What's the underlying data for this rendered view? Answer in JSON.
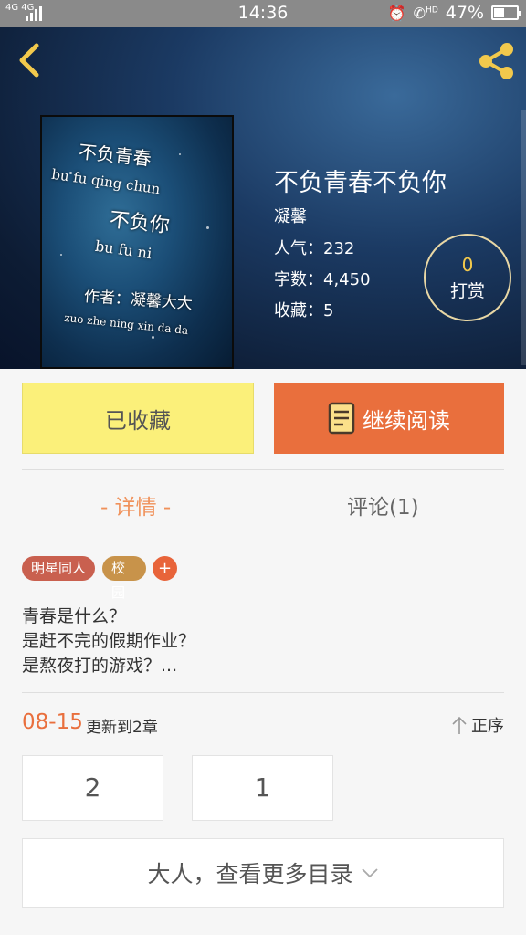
{
  "status_bar": {
    "network": "4G 4G",
    "time": "14:36",
    "hd_label": "HD",
    "battery": "47%",
    "battery_level": 0.47
  },
  "header": {
    "back_icon": "chevron-left-icon",
    "share_icon": "share-icon"
  },
  "book": {
    "cover_lines": [
      "不负青春",
      "bu fu qing chun",
      "不负你",
      "bu fu ni",
      "作者：凝馨大大",
      "zuo zhe  ning xin da da"
    ],
    "title": "不负青春不负你",
    "author": "凝馨",
    "popularity": "人气：232",
    "word_count": "字数：4,450",
    "favorites": "收藏：5",
    "tip_count": "0",
    "tip_label": "打赏"
  },
  "actions": {
    "collected_label": "已收藏",
    "continue_label": "继续阅读"
  },
  "tabs": {
    "details": "- 详情 -",
    "comments": "评论(1)"
  },
  "tags": [
    "明星同人",
    "校园",
    "+"
  ],
  "description": [
    "青春是什么？",
    "是赶不完的假期作业？",
    "是熬夜打的游戏？..."
  ],
  "updates": {
    "date": "08-15",
    "text": "更新到2章",
    "sort_label": "正序"
  },
  "chapters": [
    "2",
    "1"
  ],
  "more_catalog": "大人，查看更多目录",
  "colors": {
    "accent_orange": "#e96f3d",
    "collect_yellow": "#fbf07a",
    "icon_gold": "#f2c94c"
  }
}
